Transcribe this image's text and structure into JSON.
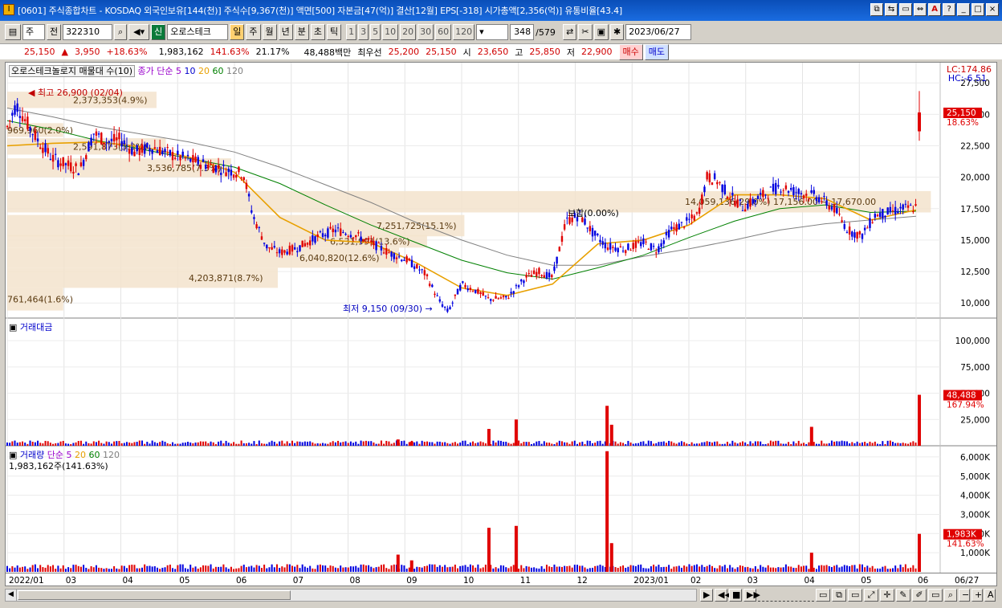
{
  "window": {
    "title": "[0601] 주식종합차트 - KOSDAQ 외국인보유[144(천)] 주식수[9,367(천)] 액면[500] 자본금[47(억)] 결산[12월] EPS[-318] 시가총액[2,356(억)] 유통비율[43.4]",
    "buttons": [
      "⧉",
      "⇆",
      "▭",
      "⇔",
      "A",
      "?",
      "_",
      "□",
      "×"
    ]
  },
  "toolbar": {
    "code_type": "주",
    "prev_label": "전",
    "stock_code": "322310",
    "stock_name": "오로스테크",
    "badge_new": "신",
    "period_buttons": [
      "일",
      "주",
      "월",
      "년",
      "분",
      "초",
      "틱"
    ],
    "period_selected": "일",
    "interval_buttons": [
      "1",
      "3",
      "5",
      "10",
      "20",
      "30",
      "60",
      "120"
    ],
    "count": "348",
    "total": "/579",
    "date": "2023/06/27"
  },
  "quote": {
    "price": "25,150",
    "change": "3,950",
    "change_pct": "+18.63%",
    "volume": "1,983,162",
    "volume_ratio": "141.63%",
    "turnover": "21.17%",
    "amount": "48,488백만",
    "best_ask_label": "최우선",
    "best_ask": "25,200",
    "best_bid": "25,150",
    "open_label": "시",
    "open": "23,650",
    "high_label": "고",
    "high": "25,850",
    "low_label": "저",
    "low": "22,900",
    "buy_button": "매수",
    "sell_button": "매도"
  },
  "price_pane": {
    "legend_title": "오로스테크놀로지 매물대 수(10)",
    "legend_ma": "종가 단순",
    "ma_periods": [
      "5",
      "10",
      "20",
      "60",
      "120"
    ],
    "ma_colors": [
      "#9900cc",
      "#0000cc",
      "#e8a000",
      "#008000",
      "#808080"
    ],
    "lc": "LC:174.86",
    "hc": "HC:-6.51",
    "current_price_tag": "25,150",
    "current_pct_tag": "18.63%",
    "high_note": "최고 26,900 (02/04)",
    "low_note": "최저 9,150 (09/30)",
    "flat_note": "보합(0.00%)",
    "volume_profile_labels": [
      "2,373,353(4.9%)",
      "969,960(2.0%)",
      "2,591,873(5.3%)",
      "3,536,785(7.3%)",
      "14,059,136(29.0%) 17,156.00 ~ 17,670.00",
      "7,251,725(15.1%)",
      "6,531,991(13.6%)",
      "6,040,820(12.6%)",
      "4,203,871(8.7%)",
      "761,464(1.6%)"
    ]
  },
  "amount_pane": {
    "legend": "거래대금",
    "tag_value": "48,488",
    "tag_pct": "167.94%"
  },
  "volume_pane": {
    "legend": "거래량",
    "legend_ma": "단순",
    "ma_periods": [
      "5",
      "20",
      "60",
      "120"
    ],
    "current": "1,983,162주(141.63%)",
    "tag_value": "1,983K",
    "tag_pct": "141.63%"
  },
  "chart_data": {
    "type": "candlestick",
    "price_axis": {
      "ticks": [
        "27,500",
        "25,000",
        "22,500",
        "20,000",
        "17,500",
        "15,000",
        "12,500",
        "10,000"
      ],
      "range": [
        8800,
        28600
      ]
    },
    "amount_axis": {
      "ticks": [
        "100,000",
        "75,000",
        "50,000",
        "25,000"
      ],
      "range": [
        0,
        120000
      ]
    },
    "volume_axis": {
      "ticks": [
        "6,000K",
        "5,000K",
        "4,000K",
        "3,000K",
        "2,000K",
        "1,000K"
      ],
      "range": [
        0,
        6500
      ]
    },
    "x_labels": [
      "2022/01",
      "03",
      "04",
      "05",
      "06",
      "07",
      "08",
      "09",
      "10",
      "11",
      "12",
      "2023/01",
      "02",
      "03",
      "04",
      "05",
      "06",
      "06/27"
    ],
    "price_path": [
      [
        0,
        24000
      ],
      [
        0.01,
        25800
      ],
      [
        0.02,
        24500
      ],
      [
        0.035,
        22800
      ],
      [
        0.05,
        21500
      ],
      [
        0.065,
        21000
      ],
      [
        0.08,
        20600
      ],
      [
        0.095,
        23500
      ],
      [
        0.11,
        22800
      ],
      [
        0.125,
        23000
      ],
      [
        0.14,
        22000
      ],
      [
        0.16,
        22400
      ],
      [
        0.18,
        21800
      ],
      [
        0.2,
        21400
      ],
      [
        0.22,
        21000
      ],
      [
        0.24,
        20600
      ],
      [
        0.26,
        20300
      ],
      [
        0.27,
        17000
      ],
      [
        0.285,
        14500
      ],
      [
        0.3,
        14000
      ],
      [
        0.32,
        14400
      ],
      [
        0.34,
        15200
      ],
      [
        0.36,
        15800
      ],
      [
        0.38,
        15500
      ],
      [
        0.4,
        14800
      ],
      [
        0.42,
        14000
      ],
      [
        0.44,
        13400
      ],
      [
        0.46,
        12300
      ],
      [
        0.475,
        10200
      ],
      [
        0.485,
        9300
      ],
      [
        0.5,
        11500
      ],
      [
        0.515,
        11000
      ],
      [
        0.53,
        10300
      ],
      [
        0.55,
        10400
      ],
      [
        0.57,
        12000
      ],
      [
        0.585,
        12500
      ],
      [
        0.6,
        12000
      ],
      [
        0.615,
        16500
      ],
      [
        0.63,
        17000
      ],
      [
        0.645,
        15500
      ],
      [
        0.66,
        14500
      ],
      [
        0.68,
        14300
      ],
      [
        0.7,
        14800
      ],
      [
        0.715,
        14200
      ],
      [
        0.73,
        15800
      ],
      [
        0.745,
        16300
      ],
      [
        0.76,
        17000
      ],
      [
        0.77,
        20000
      ],
      [
        0.78,
        19800
      ],
      [
        0.795,
        18500
      ],
      [
        0.81,
        17600
      ],
      [
        0.83,
        18500
      ],
      [
        0.85,
        19300
      ],
      [
        0.87,
        18800
      ],
      [
        0.89,
        18500
      ],
      [
        0.91,
        17500
      ],
      [
        0.925,
        15800
      ],
      [
        0.94,
        15300
      ],
      [
        0.955,
        17000
      ],
      [
        0.97,
        17200
      ],
      [
        0.985,
        17500
      ],
      [
        1.0,
        17600
      ]
    ],
    "ma20_path": [
      [
        0,
        22500
      ],
      [
        0.05,
        22700
      ],
      [
        0.1,
        22800
      ],
      [
        0.15,
        22400
      ],
      [
        0.2,
        21600
      ],
      [
        0.25,
        20400
      ],
      [
        0.3,
        16800
      ],
      [
        0.35,
        15000
      ],
      [
        0.4,
        14800
      ],
      [
        0.45,
        13200
      ],
      [
        0.5,
        11200
      ],
      [
        0.55,
        10600
      ],
      [
        0.6,
        11500
      ],
      [
        0.65,
        14700
      ],
      [
        0.7,
        15000
      ],
      [
        0.75,
        16200
      ],
      [
        0.8,
        18600
      ],
      [
        0.85,
        18600
      ],
      [
        0.9,
        18300
      ],
      [
        0.95,
        16600
      ],
      [
        1.0,
        17400
      ]
    ],
    "ma60_path": [
      [
        0,
        24500
      ],
      [
        0.05,
        23800
      ],
      [
        0.1,
        22900
      ],
      [
        0.15,
        22200
      ],
      [
        0.2,
        21500
      ],
      [
        0.25,
        20800
      ],
      [
        0.3,
        19500
      ],
      [
        0.35,
        17800
      ],
      [
        0.4,
        16200
      ],
      [
        0.45,
        14800
      ],
      [
        0.5,
        13400
      ],
      [
        0.55,
        12400
      ],
      [
        0.6,
        11900
      ],
      [
        0.65,
        12800
      ],
      [
        0.7,
        13800
      ],
      [
        0.75,
        15200
      ],
      [
        0.8,
        16500
      ],
      [
        0.85,
        17500
      ],
      [
        0.9,
        17800
      ],
      [
        0.95,
        17200
      ],
      [
        1.0,
        17300
      ]
    ],
    "ma120_path": [
      [
        0,
        25500
      ],
      [
        0.05,
        24800
      ],
      [
        0.1,
        24000
      ],
      [
        0.15,
        23400
      ],
      [
        0.2,
        22800
      ],
      [
        0.25,
        22000
      ],
      [
        0.3,
        20800
      ],
      [
        0.35,
        19400
      ],
      [
        0.4,
        18000
      ],
      [
        0.45,
        16400
      ],
      [
        0.5,
        15000
      ],
      [
        0.55,
        13800
      ],
      [
        0.6,
        13000
      ],
      [
        0.65,
        13000
      ],
      [
        0.7,
        13700
      ],
      [
        0.75,
        14300
      ],
      [
        0.8,
        15000
      ],
      [
        0.85,
        15800
      ],
      [
        0.9,
        16300
      ],
      [
        0.95,
        16600
      ],
      [
        1.0,
        16900
      ]
    ],
    "last_candle": {
      "open": 23650,
      "high": 25850,
      "low": 22900,
      "close": 25150
    },
    "volume_spikes": [
      {
        "x": 0.43,
        "amount": 6000,
        "volume": 900
      },
      {
        "x": 0.445,
        "amount": 4000,
        "volume": 600
      },
      {
        "x": 0.53,
        "amount": 16000,
        "volume": 2300
      },
      {
        "x": 0.56,
        "amount": 25000,
        "volume": 2400
      },
      {
        "x": 0.66,
        "amount": 38000,
        "volume": 6300
      },
      {
        "x": 0.665,
        "amount": 20000,
        "volume": 1500
      },
      {
        "x": 0.885,
        "amount": 18000,
        "volume": 1000
      },
      {
        "x": 1.0,
        "amount": 48488,
        "volume": 1983
      }
    ]
  }
}
